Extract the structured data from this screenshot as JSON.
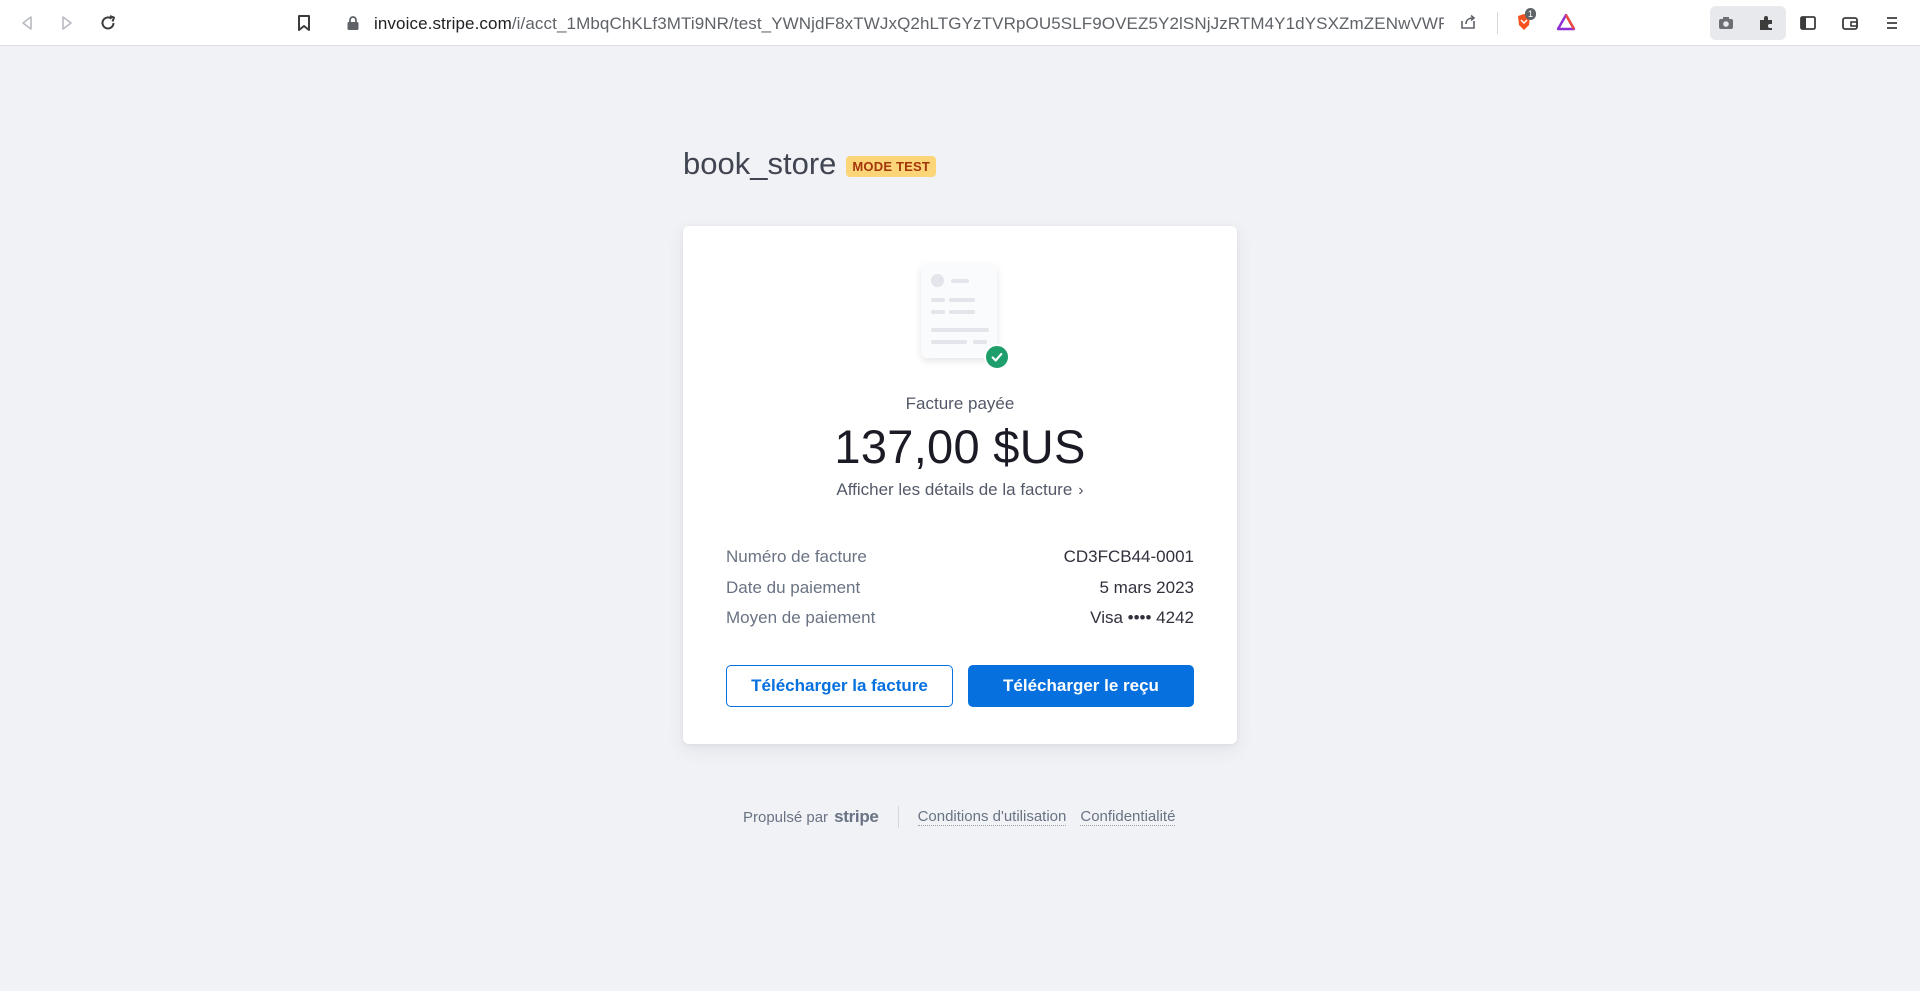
{
  "browser": {
    "url_host": "invoice.stripe.com",
    "url_path": "/i/acct_1MbqChKLf3MTi9NR/test_YWNjdF8xTWJxQ2hLTGYzTVRpOU5SLF9OVEZ5Y2lSNjJzRTM4Y1dYSXZmZENwVWRNa...",
    "brave_badge_count": "1",
    "icons": [
      "back-icon",
      "forward-icon",
      "reload-icon",
      "bookmark-icon",
      "lock-icon",
      "share-icon",
      "brave-shield-icon",
      "brave-rewards-icon",
      "camera-icon",
      "extensions-icon",
      "sidebar-icon",
      "wallet-icon",
      "menu-icon"
    ]
  },
  "merchant": {
    "name": "book_store",
    "badge": "MODE TEST"
  },
  "invoice": {
    "status": "Facture payée",
    "amount": "137,00 $US",
    "details_link": "Afficher les détails de la facture",
    "rows": [
      {
        "label": "Numéro de facture",
        "value": "CD3FCB44-0001"
      },
      {
        "label": "Date du paiement",
        "value": "5 mars 2023"
      },
      {
        "label": "Moyen de paiement",
        "value": "Visa •••• 4242"
      }
    ],
    "download_invoice": "Télécharger la facture",
    "download_receipt": "Télécharger le reçu"
  },
  "footer": {
    "powered_by": "Propulsé par",
    "brand": "stripe",
    "terms": "Conditions d'utilisation",
    "privacy": "Confidentialité"
  },
  "colors": {
    "accent": "#0570de",
    "background": "#f1f2f6",
    "badge_bg": "#fcd579",
    "badge_text": "#a2370b",
    "success": "#1e9e6a"
  }
}
